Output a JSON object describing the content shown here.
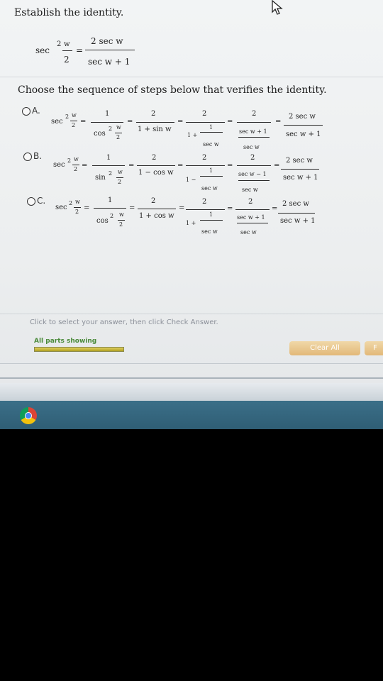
{
  "prompt": {
    "title": "Establish the identity.",
    "identity": {
      "lhs_func": "sec",
      "lhs_num": "w",
      "lhs_den": "2",
      "lhs_exp": "2",
      "eq": "=",
      "rhs_num": "2 sec w",
      "rhs_den": "sec w + 1"
    },
    "choose": "Choose the sequence of steps below that verifies the identity."
  },
  "options": [
    {
      "label": "A.",
      "func": "sec",
      "exp": "2",
      "arg_num": "w",
      "arg_den": "2",
      "s1_num": "1",
      "s1_func": "cos",
      "s1_exp": "2",
      "s1_arg_num": "w",
      "s1_arg_den": "2",
      "s2_num": "2",
      "s2_den": "1 + sin w",
      "s3_num": "2",
      "s3_pre": "1 +",
      "s3_inner_num": "1",
      "s3_inner_den": "sec w",
      "s4_num": "2",
      "s4_inner_num": "sec w + 1",
      "s4_inner_den": "sec w",
      "s5_num": "2 sec w",
      "s5_den": "sec w + 1"
    },
    {
      "label": "B.",
      "func": "sec",
      "exp": "2",
      "arg_num": "w",
      "arg_den": "2",
      "s1_num": "1",
      "s1_func": "sin",
      "s1_exp": "2",
      "s1_arg_num": "w",
      "s1_arg_den": "2",
      "s2_num": "2",
      "s2_den": "1 − cos w",
      "s3_num": "2",
      "s3_pre": "1 −",
      "s3_inner_num": "1",
      "s3_inner_den": "sec w",
      "s4_num": "2",
      "s4_inner_num": "sec w − 1",
      "s4_inner_den": "sec w",
      "s5_num": "2 sec w",
      "s5_den": "sec w + 1"
    },
    {
      "label": "C.",
      "func": "sec",
      "exp": "2",
      "arg_num": "w",
      "arg_den": "2",
      "s1_num": "1",
      "s1_func": "cos",
      "s1_exp": "2",
      "s1_arg_num": "w",
      "s1_arg_den": "2",
      "s2_num": "2",
      "s2_den": "1 + cos w",
      "s3_num": "2",
      "s3_pre": "1 +",
      "s3_inner_num": "1",
      "s3_inner_den": "sec w",
      "s4_num": "2",
      "s4_inner_num": "sec w + 1",
      "s4_inner_den": "sec w",
      "s5_num": "2 sec w",
      "s5_den": "sec w + 1"
    }
  ],
  "footer": {
    "hint": "Click to select your answer, then click Check Answer.",
    "parts": "All parts showing",
    "clear_all": "Clear All",
    "next": "F"
  },
  "icons": {
    "browser": "chrome-icon",
    "cursor": "mouse-pointer-icon"
  },
  "colors": {
    "accent_button": "#e2b878",
    "parts_text": "#4a8a3a",
    "taskbar": "#3b6f88"
  }
}
